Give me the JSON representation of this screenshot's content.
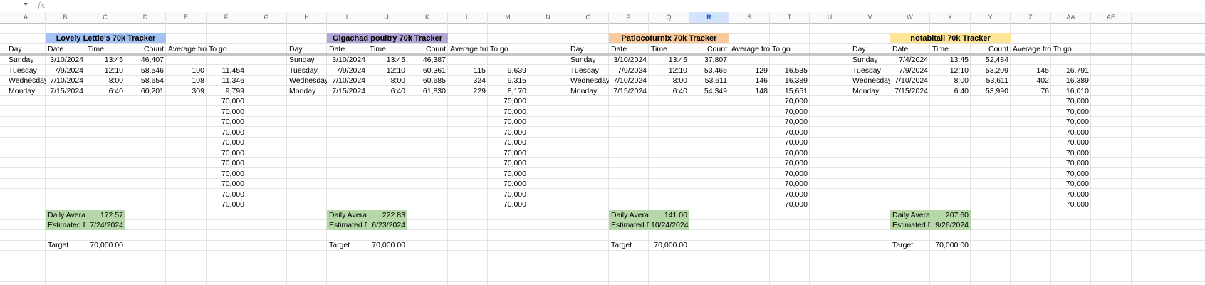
{
  "formula_bar": {
    "fx": "fx",
    "value": ""
  },
  "column_headers": [
    "A",
    "B",
    "C",
    "D",
    "E",
    "F",
    "G",
    "H",
    "I",
    "J",
    "K",
    "L",
    "M",
    "N",
    "O",
    "P",
    "Q",
    "R",
    "S",
    "T",
    "U",
    "V",
    "W",
    "X",
    "Y",
    "Z",
    "AA",
    "AE"
  ],
  "selected_column": "R",
  "trackers": [
    {
      "title": "Lovely Lettie's 70k Tracker",
      "title_color": "#a4c2f4",
      "headers": {
        "day": "Day",
        "date": "Date",
        "time": "Time",
        "count": "Count",
        "avg": "Average from",
        "togo": "To go"
      },
      "rows": [
        {
          "day": "Sunday",
          "date": "3/10/2024",
          "time": "13:45",
          "count": "46,407",
          "avg": "",
          "togo": ""
        },
        {
          "day": "Tuesday",
          "date": "7/9/2024",
          "time": "12:10",
          "count": "58,546",
          "avg": "100",
          "togo": "11,454"
        },
        {
          "day": "Wednesday",
          "date": "7/10/2024",
          "time": "8:00",
          "count": "58,654",
          "avg": "108",
          "togo": "11,346"
        },
        {
          "day": "Monday",
          "date": "7/15/2024",
          "time": "6:40",
          "count": "60,201",
          "avg": "309",
          "togo": "9,799"
        }
      ],
      "filler": [
        "70,000",
        "70,000",
        "70,000",
        "70,000",
        "70,000",
        "70,000",
        "70,000",
        "70,000",
        "70,000",
        "70,000",
        "70,000"
      ],
      "summary": {
        "daily_label": "Daily Average",
        "daily_value": "172.57",
        "est_label": "Estimated Date",
        "est_value": "7/24/2024",
        "target_label": "Target",
        "target_value": "70,000.00"
      }
    },
    {
      "title": "Gigachad poultry 70k Tracker",
      "title_color": "#b4a7d6",
      "headers": {
        "day": "Day",
        "date": "Date",
        "time": "Time",
        "count": "Count",
        "avg": "Average from",
        "togo": "To go"
      },
      "rows": [
        {
          "day": "Sunday",
          "date": "3/10/2024",
          "time": "13:45",
          "count": "46,387",
          "avg": "",
          "togo": ""
        },
        {
          "day": "Tuesday",
          "date": "7/9/2024",
          "time": "12:10",
          "count": "60,361",
          "avg": "115",
          "togo": "9,639"
        },
        {
          "day": "Wednesday",
          "date": "7/10/2024",
          "time": "8:00",
          "count": "60,685",
          "avg": "324",
          "togo": "9,315"
        },
        {
          "day": "Monday",
          "date": "7/15/2024",
          "time": "6:40",
          "count": "61,830",
          "avg": "229",
          "togo": "8,170"
        }
      ],
      "filler": [
        "70,000",
        "70,000",
        "70,000",
        "70,000",
        "70,000",
        "70,000",
        "70,000",
        "70,000",
        "70,000",
        "70,000",
        "70,000"
      ],
      "summary": {
        "daily_label": "Daily Average",
        "daily_value": "222.83",
        "est_label": "Estimated Date",
        "est_value": "6/23/2024",
        "target_label": "Target",
        "target_value": "70,000.00"
      }
    },
    {
      "title": "Patiocoturnix 70k Tracker",
      "title_color": "#f9cb9c",
      "headers": {
        "day": "Day",
        "date": "Date",
        "time": "Time",
        "count": "Count",
        "avg": "Average from",
        "togo": "To go"
      },
      "rows": [
        {
          "day": "Sunday",
          "date": "3/10/2024",
          "time": "13:45",
          "count": "37,807",
          "avg": "",
          "togo": ""
        },
        {
          "day": "Tuesday",
          "date": "7/9/2024",
          "time": "12:10",
          "count": "53,465",
          "avg": "129",
          "togo": "16,535"
        },
        {
          "day": "Wednesday",
          "date": "7/10/2024",
          "time": "8:00",
          "count": "53,611",
          "avg": "146",
          "togo": "16,389"
        },
        {
          "day": "Monday",
          "date": "7/15/2024",
          "time": "6:40",
          "count": "54,349",
          "avg": "148",
          "togo": "15,651"
        }
      ],
      "filler": [
        "70,000",
        "70,000",
        "70,000",
        "70,000",
        "70,000",
        "70,000",
        "70,000",
        "70,000",
        "70,000",
        "70,000",
        "70,000"
      ],
      "summary": {
        "daily_label": "Daily Average",
        "daily_value": "141.00",
        "est_label": "Estimated Date",
        "est_value": "10/24/2024",
        "target_label": "Target",
        "target_value": "70,000.00"
      }
    },
    {
      "title": "notabitail  70k Tracker",
      "title_color": "#ffe599",
      "headers": {
        "day": "Day",
        "date": "Date",
        "time": "Time",
        "count": "Count",
        "avg": "Average from",
        "togo": "To go"
      },
      "rows": [
        {
          "day": "Sunday",
          "date": "7/4/2024",
          "time": "13:45",
          "count": "52,484",
          "avg": "",
          "togo": ""
        },
        {
          "day": "Tuesday",
          "date": "7/9/2024",
          "time": "12:10",
          "count": "53,209",
          "avg": "145",
          "togo": "16,791"
        },
        {
          "day": "Wednesday",
          "date": "7/10/2024",
          "time": "8:00",
          "count": "53,611",
          "avg": "402",
          "togo": "16,389"
        },
        {
          "day": "Monday",
          "date": "7/15/2024",
          "time": "6:40",
          "count": "53,990",
          "avg": "76",
          "togo": "16,010"
        }
      ],
      "filler": [
        "70,000",
        "70,000",
        "70,000",
        "70,000",
        "70,000",
        "70,000",
        "70,000",
        "70,000",
        "70,000",
        "70,000",
        "70,000"
      ],
      "summary": {
        "daily_label": "Daily Average",
        "daily_value": "207.60",
        "est_label": "Estimated Date",
        "est_value": "9/26/2024",
        "target_label": "Target",
        "target_value": "70,000.00"
      }
    }
  ]
}
